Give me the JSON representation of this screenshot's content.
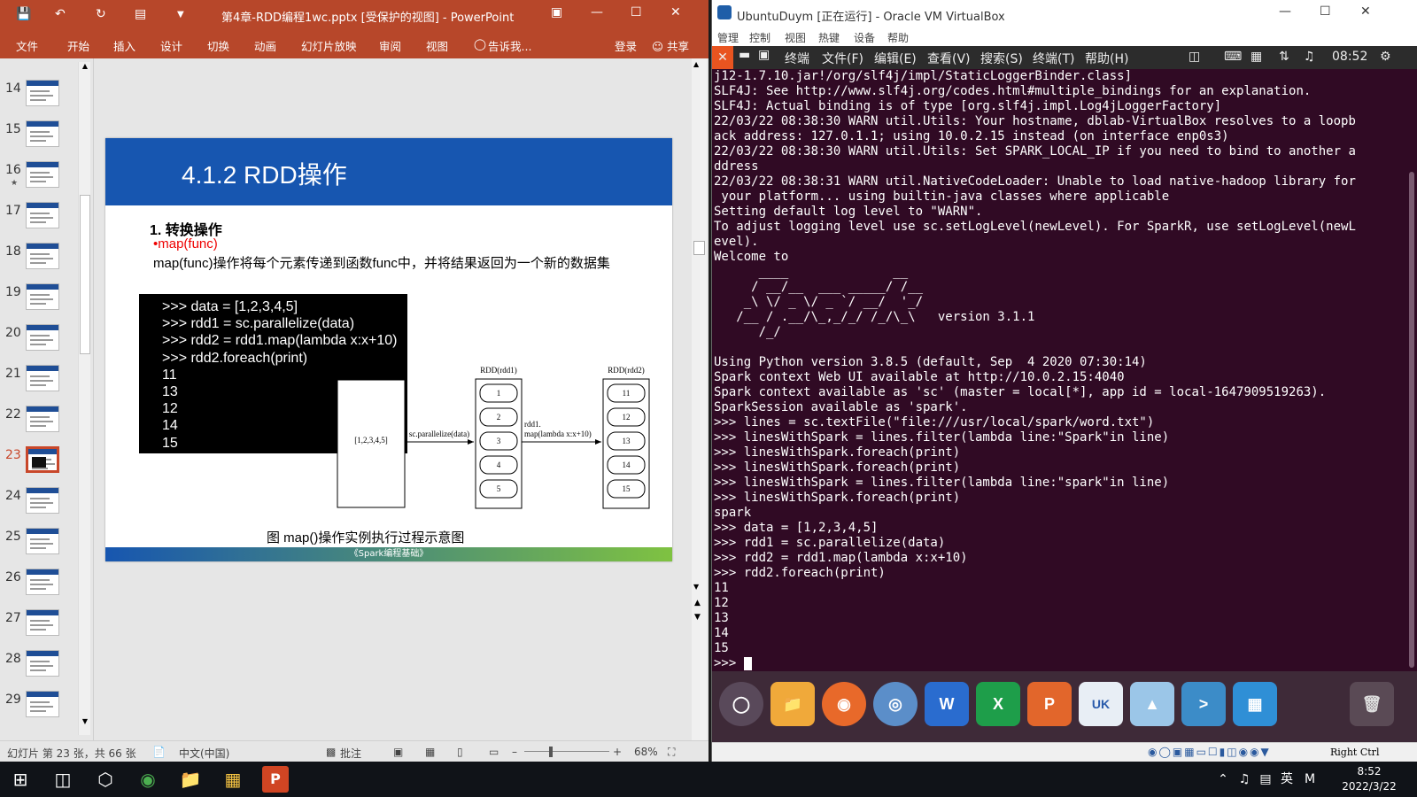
{
  "ppt": {
    "title": "第4章-RDD编程1wc.pptx [受保护的视图] - PowerPoint",
    "tabs": [
      "文件",
      "开始",
      "插入",
      "设计",
      "切换",
      "动画",
      "幻灯片放映",
      "审阅",
      "视图"
    ],
    "tell_me": "告诉我...",
    "login": "登录",
    "share": "共享",
    "thumb_numbers": [
      "14",
      "15",
      "16",
      "17",
      "18",
      "19",
      "20",
      "21",
      "22",
      "23",
      "24",
      "25",
      "26",
      "27",
      "28",
      "29"
    ],
    "selected_slide": "23",
    "slide": {
      "title": "4.1.2 RDD操作",
      "heading": "1. 转换操作",
      "bullet": "•map(func)",
      "desc": "map(func)操作将每个元素传递到函数func中，并将结果返回为一个新的数据集",
      "code_lines": [
        ">>> data = [1,2,3,4,5]",
        ">>> rdd1 = sc.parallelize(data)",
        ">>> rdd2 = rdd1.map(lambda x:x+10)",
        ">>> rdd2.foreach(print)",
        "11",
        "13",
        "12",
        "14",
        "15"
      ],
      "diagram": {
        "source_label": "[1,2,3,4,5]",
        "arrow1_label": "sc.parallelize(data)",
        "rdd1_title": "RDD(rdd1)",
        "rdd1_items": [
          "1",
          "2",
          "3",
          "4",
          "5"
        ],
        "arrow2_label1": "rdd1.",
        "arrow2_label2": "map(lambda x:x+10)",
        "rdd2_title": "RDD(rdd2)",
        "rdd2_items": [
          "11",
          "12",
          "13",
          "14",
          "15"
        ]
      },
      "caption": "图 map()操作实例执行过程示意图",
      "footer": "《Spark编程基础》"
    },
    "status": {
      "slide_info": "幻灯片 第 23 张，共 66 张",
      "language": "中文(中国)",
      "notes": "批注",
      "zoom": "68%"
    }
  },
  "vbox": {
    "title": "UbuntuDuym [正在运行] - Oracle VM VirtualBox",
    "menu": [
      "管理",
      "控制",
      "视图",
      "热键",
      "设备",
      "帮助"
    ],
    "ubuntu_bar": {
      "app": "终端",
      "menus": [
        "文件(F)",
        "编辑(E)",
        "查看(V)",
        "搜索(S)",
        "终端(T)",
        "帮助(H)"
      ],
      "time": "08:52"
    },
    "terminal_lines": [
      "j12-1.7.10.jar!/org/slf4j/impl/StaticLoggerBinder.class]",
      "SLF4J: See http://www.slf4j.org/codes.html#multiple_bindings for an explanation.",
      "SLF4J: Actual binding is of type [org.slf4j.impl.Log4jLoggerFactory]",
      "22/03/22 08:38:30 WARN util.Utils: Your hostname, dblab-VirtualBox resolves to a loopb",
      "ack address: 127.0.1.1; using 10.0.2.15 instead (on interface enp0s3)",
      "22/03/22 08:38:30 WARN util.Utils: Set SPARK_LOCAL_IP if you need to bind to another a",
      "ddress",
      "22/03/22 08:38:31 WARN util.NativeCodeLoader: Unable to load native-hadoop library for",
      " your platform... using builtin-java classes where applicable",
      "Setting default log level to \"WARN\".",
      "To adjust logging level use sc.setLogLevel(newLevel). For SparkR, use setLogLevel(newL",
      "evel).",
      "Welcome to",
      "      ____              __",
      "     / __/__  ___ _____/ /__",
      "    _\\ \\/ _ \\/ _ `/ __/  '_/",
      "   /__ / .__/\\_,_/_/ /_/\\_\\   version 3.1.1",
      "      /_/",
      "",
      "Using Python version 3.8.5 (default, Sep  4 2020 07:30:14)",
      "Spark context Web UI available at http://10.0.2.15:4040",
      "Spark context available as 'sc' (master = local[*], app id = local-1647909519263).",
      "SparkSession available as 'spark'.",
      ">>> lines = sc.textFile(\"file:///usr/local/spark/word.txt\")",
      ">>> linesWithSpark = lines.filter(lambda line:\"Spark\"in line)",
      ">>> linesWithSpark.foreach(print)",
      ">>> linesWithSpark.foreach(print)",
      ">>> linesWithSpark = lines.filter(lambda line:\"spark\"in line)",
      ">>> linesWithSpark.foreach(print)",
      "spark",
      ">>> data = [1,2,3,4,5]",
      ">>> rdd1 = sc.parallelize(data)",
      ">>> rdd2 = rdd1.map(lambda x:x+10)",
      ">>> rdd2.foreach(print)",
      "11",
      "12",
      "13",
      "14",
      "15"
    ],
    "prompt": ">>> ",
    "dock_uk": "UK",
    "status_key": "Right Ctrl"
  },
  "taskbar": {
    "time": "8:52",
    "date": "2022/3/22",
    "ime": "英",
    "ime2": "M"
  }
}
